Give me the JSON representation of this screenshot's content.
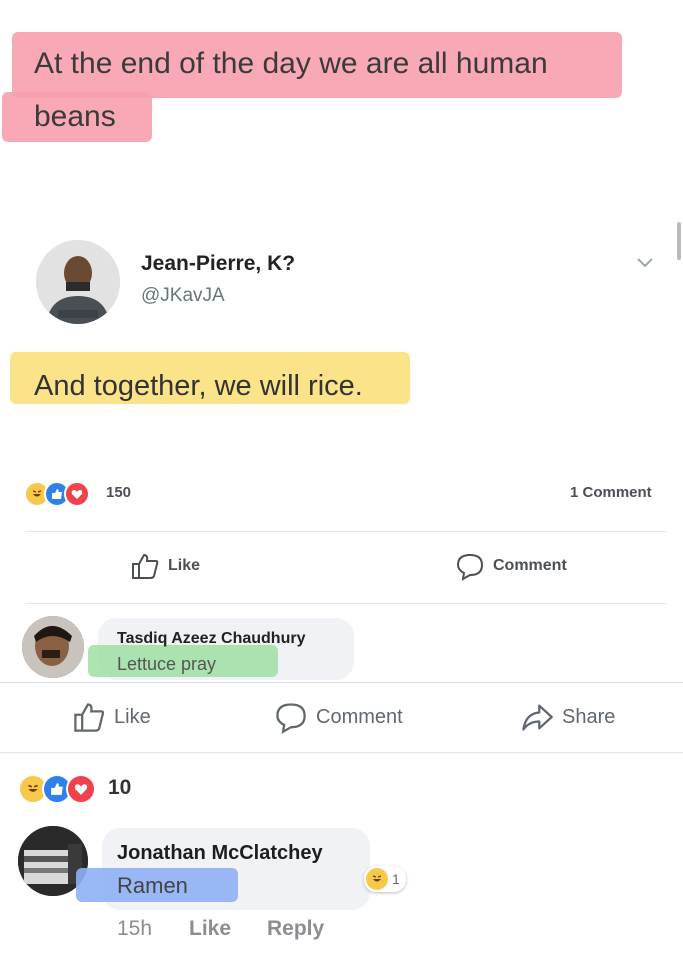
{
  "quote": {
    "line1": "At the end of the day we are all human",
    "line2": "beans"
  },
  "tweet": {
    "author_name": "Jean-Pierre, K?",
    "author_handle": "@JKavJA",
    "text": "And together, we will rice."
  },
  "inner_post": {
    "reaction_count": "150",
    "comment_count": "1 Comment",
    "like_label": "Like",
    "comment_label": "Comment",
    "comment": {
      "author": "Tasdiq Azeez Chaudhury",
      "text": "Lettuce pray"
    }
  },
  "outer_post": {
    "like_label": "Like",
    "comment_label": "Comment",
    "share_label": "Share",
    "reaction_count": "10",
    "comment": {
      "author": "Jonathan McClatchey",
      "text": "Ramen",
      "reaction_count": "1",
      "time": "15h",
      "like_label": "Like",
      "reply_label": "Reply"
    }
  },
  "colors": {
    "pink_highlight": "#f7a0ad",
    "yellow_highlight": "#fbe38a",
    "green_highlight": "#9ee0a3",
    "blue_highlight": "#8fb0f5"
  }
}
